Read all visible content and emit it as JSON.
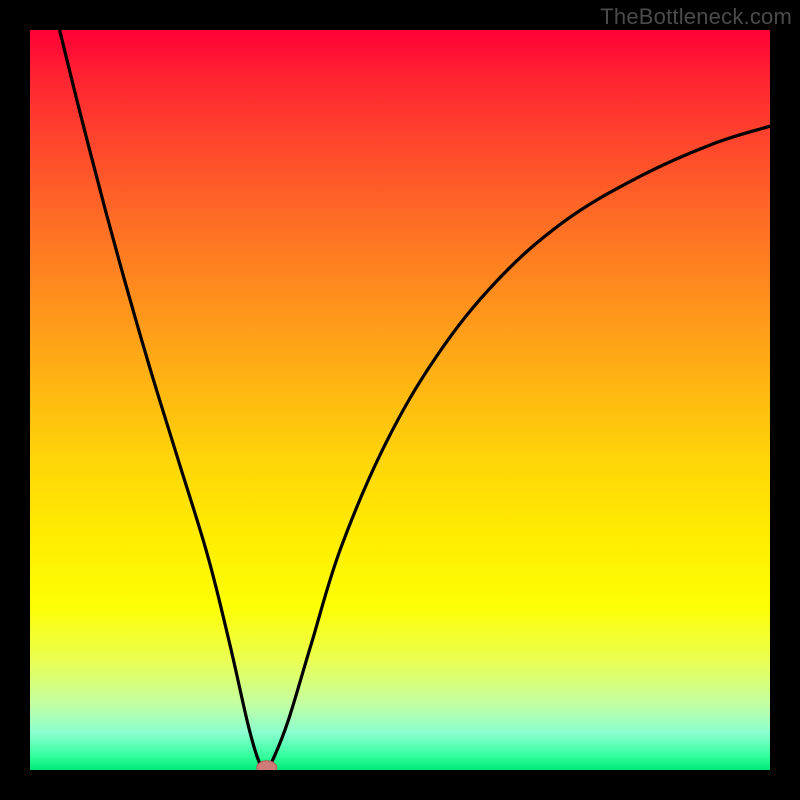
{
  "watermark": "TheBottleneck.com",
  "colors": {
    "background": "#000000",
    "watermark_text": "#4b4b4b",
    "curve_stroke": "#000000",
    "marker_fill": "#cf7b78",
    "marker_stroke": "#b55a57"
  },
  "chart_data": {
    "type": "line",
    "title": "",
    "xlabel": "",
    "ylabel": "",
    "xlim": [
      0,
      100
    ],
    "ylim": [
      0,
      100
    ],
    "grid": false,
    "legend": false,
    "notes": "Single V-shaped curve (bottleneck profile) over a vertical red→yellow→green gradient. Left branch descends steeply from top-left to a minimum; right branch rises with decreasing slope toward upper-right. Minimum marked by a small pink rounded marker.",
    "series": [
      {
        "name": "bottleneck-curve",
        "x": [
          0,
          4,
          8,
          12,
          16,
          20,
          24,
          27,
          29.5,
          31,
          32,
          33,
          35,
          38,
          42,
          48,
          55,
          63,
          72,
          82,
          92,
          100
        ],
        "values": [
          117,
          100,
          84,
          69,
          55,
          42,
          29,
          17,
          6,
          1,
          0.3,
          1.8,
          7,
          17,
          30,
          44,
          56,
          66,
          74,
          80,
          84.5,
          87
        ]
      }
    ],
    "marker": {
      "x": 32,
      "y": 0.3
    }
  }
}
